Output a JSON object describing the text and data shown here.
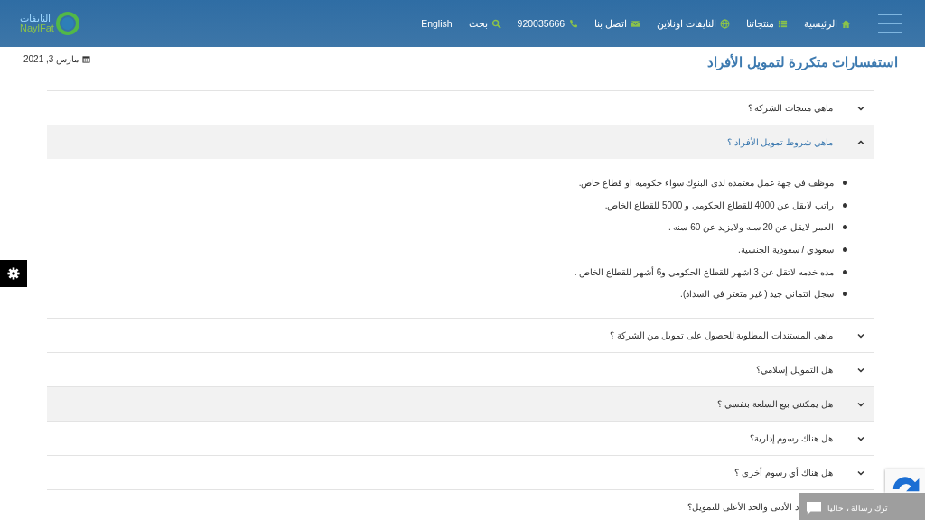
{
  "header": {
    "logo": {
      "arabic": "النايفات",
      "latin": "NaylFat"
    },
    "nav": [
      {
        "label": "الرئيسية"
      },
      {
        "label": "منتجاتنا"
      },
      {
        "label": "النايفات اونلاين"
      },
      {
        "label": "اتصل بنا"
      },
      {
        "label": "920035666"
      },
      {
        "label": "بحث"
      },
      {
        "label": "English"
      }
    ]
  },
  "date": "مارس 3, 2021",
  "title": "استفسارات متكررة لتمويل الأفراد",
  "faq": [
    {
      "question": "ماهي منتجات الشركة ؟",
      "expanded": false,
      "highlighted": false
    },
    {
      "question": "ماهي شروط تمويل الأفراد ؟",
      "expanded": true,
      "highlighted": true,
      "answer": [
        "موظف في جهة عمل  معتمده  لدى البنوك سواء حكوميه او قطاع خاص.",
        "راتب لايقل عن 4000 للقطاع  الحكومي و 5000 للقطاع  الخاص.",
        "العمر لايقل عن 20 سنه ولايزيد  عن 60 سنه .",
        "سعودي / سعودية الجنسية.",
        "مده خدمه لاتقل عن 3 اشهر للقطاع الحكومي و6 أشهر للقطاع الخاص .",
        "سجل ائتماني جيد ( غير متعثر في  السداد)."
      ]
    },
    {
      "question": "ماهي المستندات المطلوبة للحصول على تمويل من الشركة ؟",
      "expanded": false,
      "highlighted": false
    },
    {
      "question": "هل التمويل إسلامي؟",
      "expanded": false,
      "highlighted": false
    },
    {
      "question": "هل يمكنني بيع السلعة بنفسي ؟",
      "expanded": false,
      "highlighted": true
    },
    {
      "question": "هل هناك رسوم إدارية؟",
      "expanded": false,
      "highlighted": false
    },
    {
      "question": "هل هناك أي رسوم أخرى ؟",
      "expanded": false,
      "highlighted": false
    },
    {
      "question": "د الأدنى والحد الأعلى للتمويل؟",
      "expanded": false,
      "highlighted": false
    }
  ],
  "chat": {
    "label": "ترك رسالة ، حاليا"
  }
}
